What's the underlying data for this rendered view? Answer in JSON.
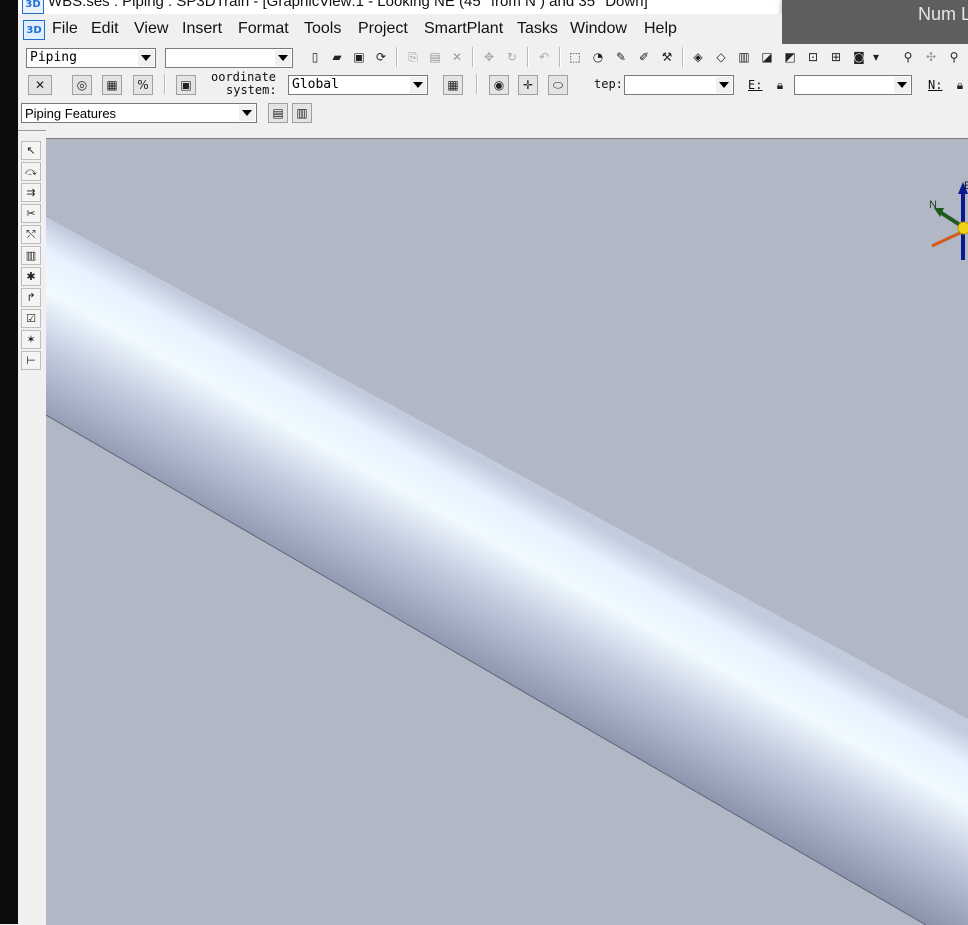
{
  "window": {
    "title": "WBS.ses : Piping : SP3DTrain - [GraphicView:1 - Looking NE (45° from N ) and 35° Down]",
    "app_icon_text": "3D",
    "overlay_text": "Num L"
  },
  "menu": {
    "items": [
      "File",
      "Edit",
      "View",
      "Insert",
      "Format",
      "Tools",
      "Project",
      "SmartPlant",
      "Tasks",
      "Window",
      "Help"
    ]
  },
  "toolbar1": {
    "task_value": "Piping",
    "second_value": ""
  },
  "toolbar2": {
    "coord_label_1": "oordinate",
    "coord_label_2": "system:",
    "coord_value": "Global",
    "step_label": "tep:",
    "step_value": "",
    "e_label": "E:",
    "e_value": "",
    "n_label": "N:"
  },
  "toolbar3": {
    "feature_value": "Piping Features"
  },
  "compass": {
    "n_label": "N",
    "e_label": "E"
  },
  "colors": {
    "viewport_bg": "#b1b7c5",
    "pipe_highlight": "#f0faff",
    "pipe_shadow": "#6e778e",
    "brand": "#1f6fd0"
  }
}
